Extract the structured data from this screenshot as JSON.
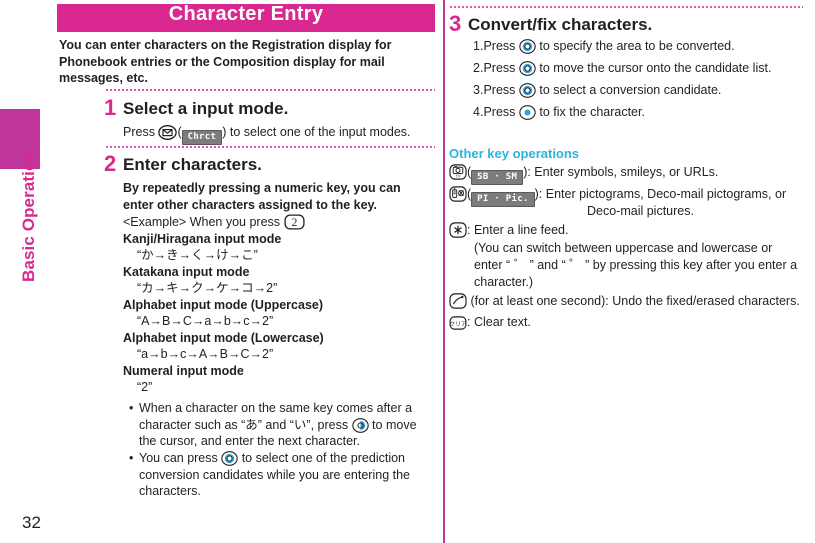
{
  "page": {
    "number": "32",
    "side_tab_label": "Basic Operation",
    "accent_magenta": "#d9288f",
    "accent_cyan": "#29b6d8",
    "key_blue": "#2ba6dd"
  },
  "chapter": {
    "title": "Character Entry",
    "intro": "You can enter characters on the Registration display for Phonebook entries or the Composition display for mail messages, etc."
  },
  "steps": [
    {
      "number": "1",
      "heading": "Select a input mode.",
      "body_pre": "Press ",
      "key_icon": "mail-key-icon",
      "softkey": "Chrct",
      "body_post": " to select one of the input modes."
    },
    {
      "number": "2",
      "heading": "Enter characters.",
      "intro": "By repeatedly pressing a numeric key, you can enter other characters assigned to the key.",
      "example_pre": "<Example> When you press ",
      "example_key": "2",
      "modes": [
        {
          "label": "Kanji/Hiragana input mode",
          "value": "“か→き→く→け→こ”"
        },
        {
          "label": "Katakana input mode",
          "value": "“カ→キ→ク→ケ→コ→2”"
        },
        {
          "label": "Alphabet input mode (Uppercase)",
          "value": "“A→B→C→a→b→c→2”"
        },
        {
          "label": "Alphabet input mode (Lowercase)",
          "value": "“a→b→c→A→B→C→2”"
        },
        {
          "label": "Numeral input mode",
          "value": "“2”"
        }
      ],
      "bullets": [
        {
          "pre": "When a character on the same key comes after a character such as “あ” and “い”, press ",
          "key_icon": "nav-key-right-icon",
          "post": " to move the cursor, and enter the next character."
        },
        {
          "pre": "You can press ",
          "key_icon": "nav-key-updown-icon",
          "post": " to select one of the prediction conversion candidates while you are entering the characters."
        }
      ]
    },
    {
      "number": "3",
      "heading": "Convert/fix characters.",
      "numbered_items": [
        {
          "marker": "1.",
          "pre": "Press ",
          "key_icon": "nav-key-leftright-icon",
          "post": " to specify the area to be converted."
        },
        {
          "marker": "2.",
          "pre": "Press ",
          "key_icon": "nav-key-updown-icon",
          "post": " to move the cursor onto the candidate list."
        },
        {
          "marker": "3.",
          "pre": "Press ",
          "key_icon": "nav-key-all-icon",
          "post": " to select a conversion candidate."
        },
        {
          "marker": "4.",
          "pre": "Press ",
          "key_icon": "nav-key-center-icon",
          "post": " to fix the character."
        }
      ]
    }
  ],
  "other_key_operations": {
    "heading": "Other key operations",
    "items": [
      {
        "key_icon": "camera-tv-key-icon",
        "softkey": "SB · SM",
        "text": "): Enter symbols, smileys, or URLs.",
        "text2": ""
      },
      {
        "key_icon": "pictogram-key-icon",
        "softkey": "PI · Pic.",
        "text": "): Enter pictograms, Deco-mail pictograms, or",
        "text2": "Deco-mail pictures."
      },
      {
        "key_icon": "asterisk-key-icon",
        "softkey": "",
        "text": ": Enter a line feed.",
        "sub": [
          "(You can switch between uppercase and lowercase or",
          "enter “ ゛ ” and “ ゜ ” by pressing this key after you enter a",
          "character.)"
        ]
      },
      {
        "key_icon": "call-key-icon",
        "softkey": "",
        "text": " (for at least one second): Undo the fixed/erased characters.",
        "text2": ""
      },
      {
        "key_icon": "clear-key-icon",
        "softkey": "",
        "text": ": Clear text.",
        "text2": ""
      }
    ]
  }
}
